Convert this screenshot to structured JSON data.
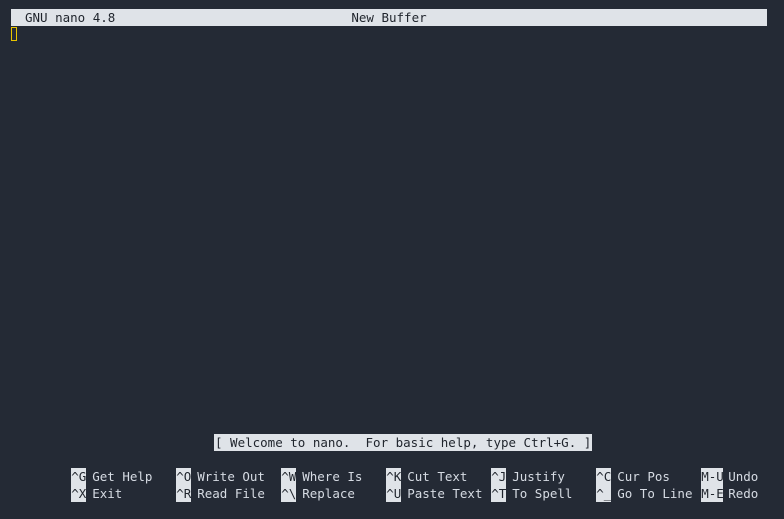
{
  "title_bar": {
    "app_version": "GNU nano 4.8",
    "file_name": "New Buffer"
  },
  "status_message": "[ Welcome to nano.  For basic help, type Ctrl+G. ]",
  "shortcuts": {
    "row1": [
      {
        "key": "^G",
        "label": "Get Help"
      },
      {
        "key": "^O",
        "label": "Write Out"
      },
      {
        "key": "^W",
        "label": "Where Is"
      },
      {
        "key": "^K",
        "label": "Cut Text"
      },
      {
        "key": "^J",
        "label": "Justify"
      },
      {
        "key": "^C",
        "label": "Cur Pos"
      },
      {
        "key": "M-U",
        "label": "Undo"
      }
    ],
    "row2": [
      {
        "key": "^X",
        "label": "Exit"
      },
      {
        "key": "^R",
        "label": "Read File"
      },
      {
        "key": "^\\",
        "label": "Replace"
      },
      {
        "key": "^U",
        "label": "Paste Text"
      },
      {
        "key": "^T",
        "label": "To Spell"
      },
      {
        "key": "^_",
        "label": "Go To Line"
      },
      {
        "key": "M-E",
        "label": "Redo"
      }
    ]
  },
  "colors": {
    "background": "#242a35",
    "bar": "#dfe3e8",
    "cursor": "#e8c400"
  }
}
